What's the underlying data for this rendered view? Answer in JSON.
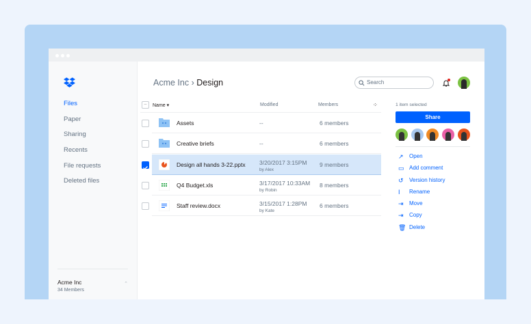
{
  "sidebar": {
    "items": [
      {
        "label": "Files",
        "active": true
      },
      {
        "label": "Paper"
      },
      {
        "label": "Sharing"
      },
      {
        "label": "Recents"
      },
      {
        "label": "File requests"
      },
      {
        "label": "Deleted files"
      }
    ],
    "team": {
      "name": "Acme Inc",
      "members": "34 Members"
    }
  },
  "header": {
    "breadcrumb_parent": "Acme Inc",
    "separator": " › ",
    "breadcrumb_current": "Design",
    "search_placeholder": "Search"
  },
  "table": {
    "columns": {
      "name": "Name ▾",
      "modified": "Modified",
      "members": "Members"
    },
    "rows": [
      {
        "name": "Assets",
        "modified": "--",
        "by": "",
        "members": "6 members",
        "icon": "shared-folder-icon",
        "checked": false
      },
      {
        "name": "Creative briefs",
        "modified": "--",
        "by": "",
        "members": "6 members",
        "icon": "shared-folder-icon",
        "checked": false
      },
      {
        "name": "Design all hands 3-22.pptx",
        "modified": "3/20/2017 3:15PM",
        "by": "by Alex",
        "members": "9 members",
        "icon": "pptx-icon",
        "checked": true
      },
      {
        "name": "Q4 Budget.xls",
        "modified": "3/17/2017 10:33AM",
        "by": "by Robin",
        "members": "8 members",
        "icon": "xls-icon",
        "checked": false
      },
      {
        "name": "Staff review.docx",
        "modified": "3/15/2017 1:28PM",
        "by": "by Kate",
        "members": "6 members",
        "icon": "docx-icon",
        "checked": false
      }
    ]
  },
  "panel": {
    "selected": "1 item selected",
    "share": "Share",
    "avatars": [
      "#7cc243",
      "#a8c8ee",
      "#f08a24",
      "#ea5fa7",
      "#e9541e"
    ],
    "actions": [
      {
        "label": "Open",
        "icon": "↗"
      },
      {
        "label": "Add comment",
        "icon": "▭"
      },
      {
        "label": "Version history",
        "icon": "↺"
      },
      {
        "label": "Rename",
        "icon": "I"
      },
      {
        "label": "Move",
        "icon": "⇥"
      },
      {
        "label": "Copy",
        "icon": "⇥"
      },
      {
        "label": "Delete",
        "icon": "🗑"
      }
    ]
  },
  "colors": {
    "accent": "#0061fe",
    "selected_row": "#d6e7fa",
    "notification": "#e0241e"
  }
}
